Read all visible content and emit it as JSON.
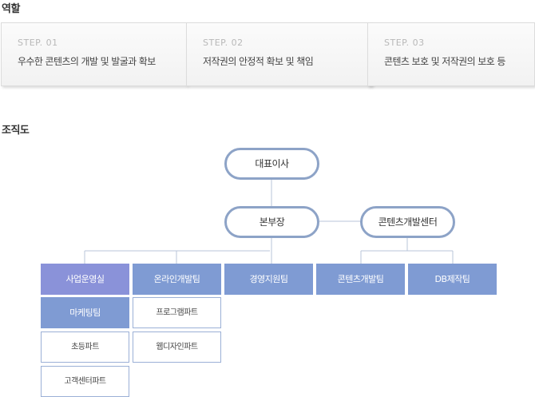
{
  "sections": {
    "role_title": "역할",
    "org_title": "조직도"
  },
  "steps": [
    {
      "num": "STEP. 01",
      "text": "우수한 콘텐츠의 개발 및 발굴과 확보"
    },
    {
      "num": "STEP. 02",
      "text": "저작권의 안정적 확보 및 책임"
    },
    {
      "num": "STEP. 03",
      "text": "콘텐츠 보호 및 저작권의 보호 등"
    }
  ],
  "org": {
    "ceo": "대표이사",
    "head": "본부장",
    "content_center": "콘텐츠개발센터",
    "departments": [
      "사업운영실",
      "온라인개발팀",
      "경영지원팀",
      "콘텐츠개발팀",
      "DB제작팀"
    ],
    "business_subs": [
      "마케팅팀",
      "초등파트",
      "고객센터파트"
    ],
    "online_subs": [
      "프로그램파트",
      "웹디자인파트"
    ]
  },
  "colors": {
    "pill_border": "#8da3c7",
    "dept_fill": "#7f9bd3",
    "dept_lead_fill": "#8a92d9",
    "line": "#b8c4d9"
  }
}
